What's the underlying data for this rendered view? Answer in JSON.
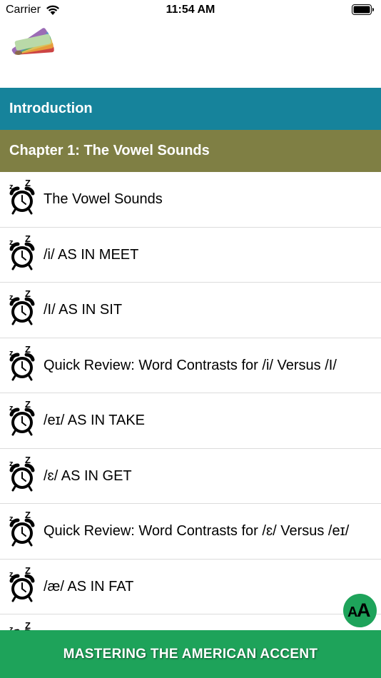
{
  "status_bar": {
    "carrier": "Carrier",
    "time": "11:54 AM",
    "icons": [
      "wifi-icon",
      "battery-icon"
    ]
  },
  "header": {
    "logo_icon": "color-swatch-fan-logo"
  },
  "sections": {
    "introduction": "Introduction",
    "chapter_title": "Chapter 1: The Vowel Sounds"
  },
  "lessons": [
    {
      "title": "The Vowel Sounds",
      "icon": "alarm-clock-icon"
    },
    {
      "title": "/i/ AS IN MEET",
      "icon": "alarm-clock-icon"
    },
    {
      "title": "/I/ AS IN SIT",
      "icon": "alarm-clock-icon"
    },
    {
      "title": "Quick Review: Word Contrasts for /i/ Versus /I/",
      "icon": "alarm-clock-icon"
    },
    {
      "title": "/eɪ/ AS IN TAKE",
      "icon": "alarm-clock-icon"
    },
    {
      "title": "/ɛ/ AS IN GET",
      "icon": "alarm-clock-icon"
    },
    {
      "title": "Quick Review: Word Contrasts for /ɛ/ Versus /eɪ/",
      "icon": "alarm-clock-icon"
    },
    {
      "title": "/æ/ AS IN FAT",
      "icon": "alarm-clock-icon"
    },
    {
      "title": "",
      "icon": "alarm-clock-icon"
    }
  ],
  "font_size_button": {
    "small": "A",
    "large": "A"
  },
  "bottom_bar": {
    "title": "MASTERING THE AMERICAN ACCENT"
  },
  "colors": {
    "introduction_bg": "#16839b",
    "chapter_bg": "#7f7f44",
    "bottom_bar_bg": "#1ea35a"
  }
}
